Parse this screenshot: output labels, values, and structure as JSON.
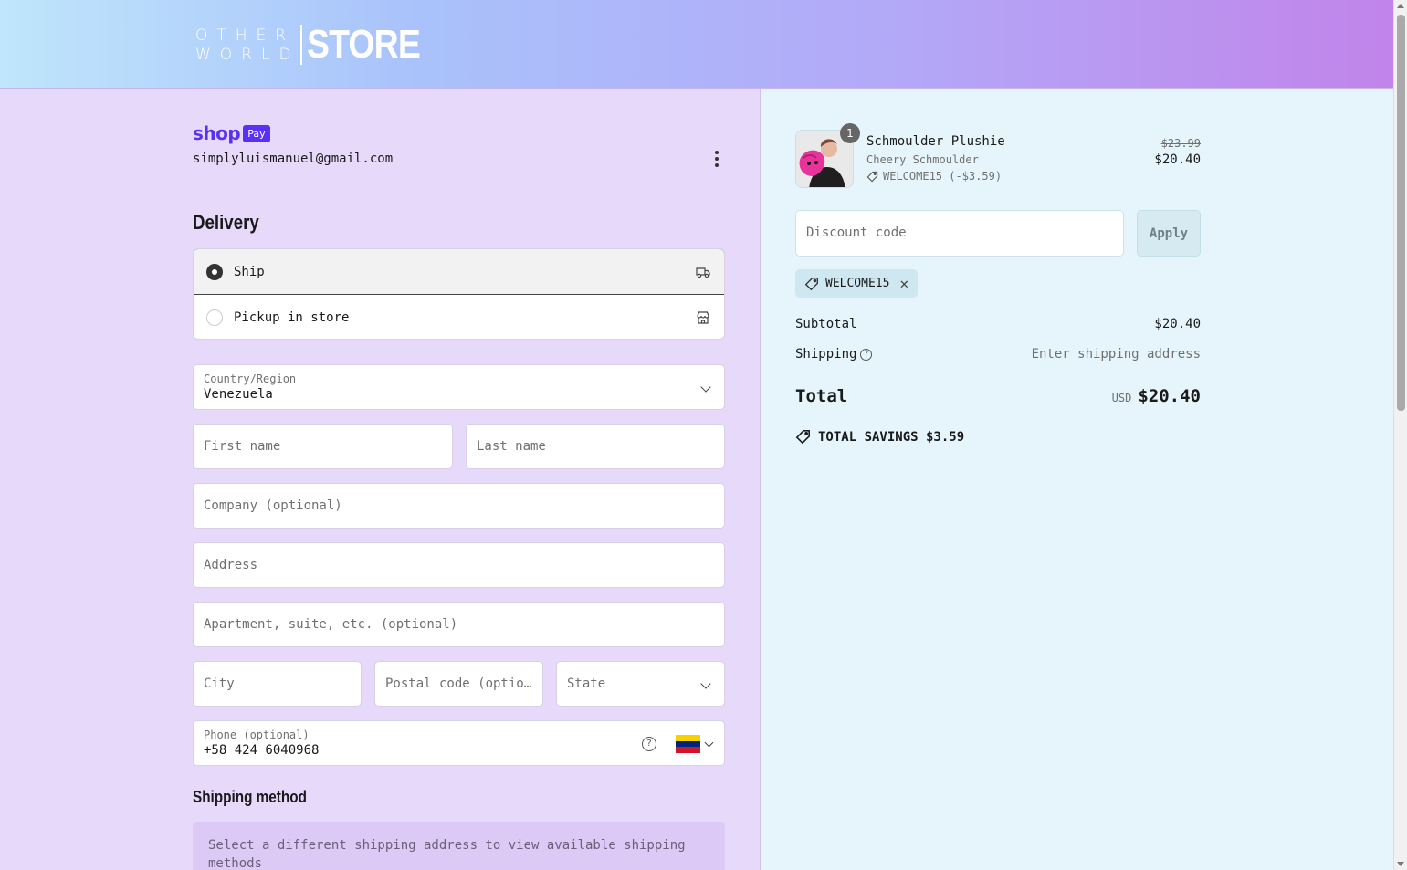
{
  "header": {
    "logo_line1": "OTHER",
    "logo_line2": "WORLD",
    "logo_store": "STORE"
  },
  "account": {
    "shop_label": "shop",
    "pay_label": "Pay",
    "email": "simplyluismanuel@gmail.com"
  },
  "delivery": {
    "heading": "Delivery",
    "options": [
      {
        "label": "Ship",
        "selected": true,
        "icon": "truck-icon"
      },
      {
        "label": "Pickup in store",
        "selected": false,
        "icon": "store-icon"
      }
    ],
    "country_label": "Country/Region",
    "country_value": "Venezuela",
    "first_name_placeholder": "First name",
    "last_name_placeholder": "Last name",
    "company_placeholder": "Company (optional)",
    "address_placeholder": "Address",
    "apartment_placeholder": "Apartment, suite, etc. (optional)",
    "city_placeholder": "City",
    "postal_placeholder": "Postal code (optio…",
    "state_placeholder": "State",
    "phone_label": "Phone (optional)",
    "phone_value": "+58 424 6040968",
    "phone_help": "?"
  },
  "shipping_method": {
    "heading": "Shipping method",
    "note": "Select a different shipping address to view available shipping methods"
  },
  "summary": {
    "product": {
      "quantity": "1",
      "name": "Schmoulder Plushie",
      "variant": "Cheery Schmoulder",
      "discount": "WELCOME15 (-$3.59)",
      "old_price": "$23.99",
      "price": "$20.40"
    },
    "discount_placeholder": "Discount code",
    "apply_label": "Apply",
    "applied_code": "WELCOME15",
    "subtotal_label": "Subtotal",
    "subtotal_value": "$20.40",
    "shipping_label": "Shipping",
    "shipping_value": "Enter shipping address",
    "total_label": "Total",
    "currency": "USD",
    "total_value": "$20.40",
    "savings": "TOTAL SAVINGS $3.59"
  },
  "colors": {
    "shop_pay": "#5a31f4",
    "left_bg": "#e6d9fa",
    "right_bg": "#e5f5fb"
  }
}
